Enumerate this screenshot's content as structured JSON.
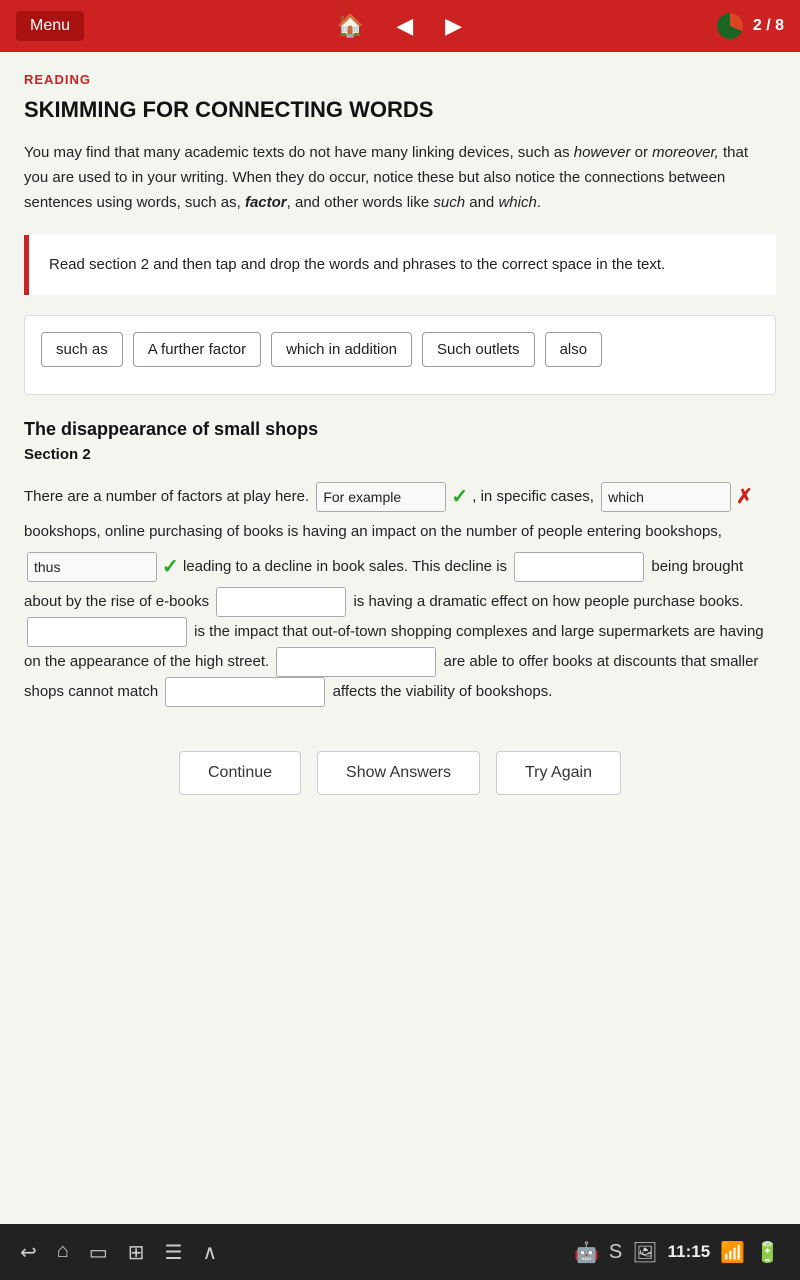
{
  "topBar": {
    "menuLabel": "Menu",
    "progress": "2 / 8",
    "homeIcon": "🏠",
    "backIcon": "◀",
    "forwardIcon": "▶"
  },
  "page": {
    "readingLabel": "READING",
    "title": "SKIMMING FOR CONNECTING WORDS",
    "introText": "You may find that many academic texts do not have many linking devices, such as however or moreover, that you are used to in your writing. When they do occur, notice these but also notice the connections between sentences using words, such as, factor, and other words like such and which.",
    "instructionBox": "Read section 2 and then tap and drop the words and phrases to the correct space in the text.",
    "wordBank": {
      "chips": [
        "such as",
        "A further factor",
        "which in addition",
        "Such outlets",
        "also"
      ]
    },
    "sectionHeading": "The disappearance of small shops",
    "sectionSub": "Section 2",
    "passage": {
      "parts": [
        {
          "type": "text",
          "content": "There are a number of factors at play here. "
        },
        {
          "type": "drop",
          "id": "dz1",
          "value": "For example",
          "status": "correct"
        },
        {
          "type": "text",
          "content": ", in specific cases, "
        },
        {
          "type": "drop",
          "id": "dz2",
          "value": "which",
          "status": "incorrect"
        },
        {
          "type": "text",
          "content": " bookshops, online purchasing of books is having an impact on the number of people entering bookshops, "
        },
        {
          "type": "drop",
          "id": "dz3",
          "value": "thus",
          "status": "correct"
        },
        {
          "type": "text",
          "content": " leading to a decline in book sales. This decline is "
        },
        {
          "type": "drop",
          "id": "dz4",
          "value": "",
          "status": "empty"
        },
        {
          "type": "text",
          "content": " being brought about by the rise of e-books "
        },
        {
          "type": "drop",
          "id": "dz5",
          "value": "",
          "status": "empty"
        },
        {
          "type": "text",
          "content": " is having a dramatic effect on how people purchase books. "
        },
        {
          "type": "drop",
          "id": "dz6",
          "value": "",
          "status": "empty"
        },
        {
          "type": "text",
          "content": " is the impact that out-of-town shopping complexes and large supermarkets are having on the appearance of the high street. "
        },
        {
          "type": "drop",
          "id": "dz7",
          "value": "",
          "status": "empty"
        },
        {
          "type": "text",
          "content": " are able to offer books at discounts that smaller shops cannot match "
        },
        {
          "type": "drop",
          "id": "dz8",
          "value": "",
          "status": "empty"
        },
        {
          "type": "text",
          "content": " affects the viability of bookshops."
        }
      ]
    },
    "buttons": {
      "continue": "Continue",
      "showAnswers": "Show Answers",
      "tryAgain": "Try Again"
    }
  },
  "systemBar": {
    "time": "11:15",
    "icons": [
      "↩",
      "⌂",
      "▭",
      "⊞",
      "☰",
      "∧"
    ]
  }
}
